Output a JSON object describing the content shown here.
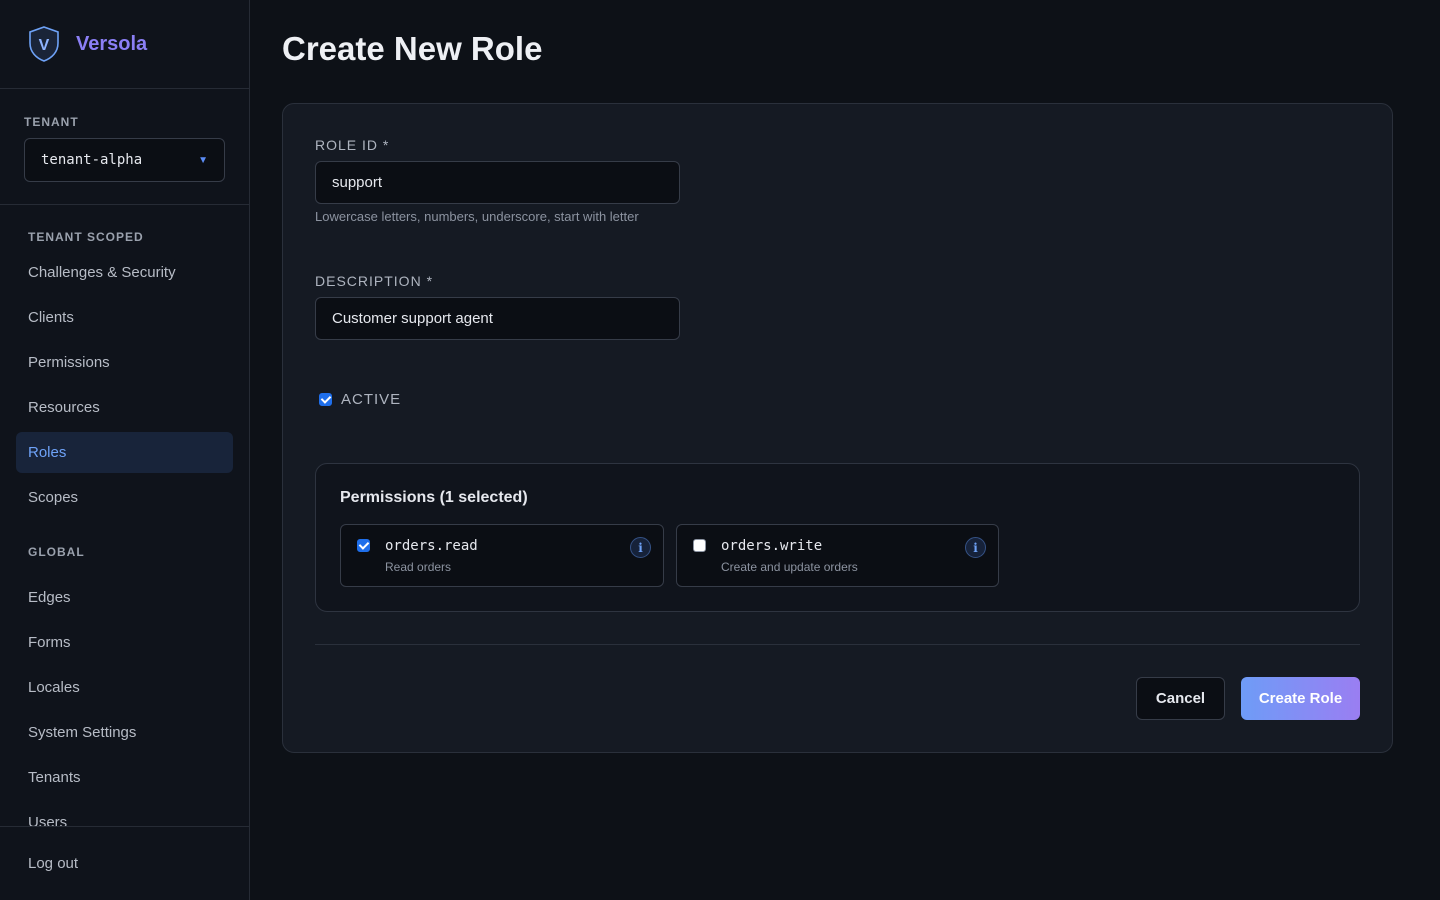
{
  "brand": {
    "name": "Versola",
    "logo_letter": "V"
  },
  "tenant": {
    "section_label": "TENANT",
    "selected": "tenant-alpha"
  },
  "nav": {
    "tenant_scoped_label": "TENANT SCOPED",
    "tenant_scoped": [
      "Challenges & Security",
      "Clients",
      "Permissions",
      "Resources",
      "Roles",
      "Scopes"
    ],
    "active_item": "Roles",
    "global_label": "GLOBAL",
    "global": [
      "Edges",
      "Forms",
      "Locales",
      "System Settings",
      "Tenants",
      "Users"
    ],
    "logout": "Log out"
  },
  "page": {
    "title": "Create New Role"
  },
  "form": {
    "role_id_label": "ROLE ID *",
    "role_id_value": "support",
    "role_id_hint": "Lowercase letters, numbers, underscore, start with letter",
    "description_label": "DESCRIPTION *",
    "description_value": "Customer support agent",
    "active_label": "ACTIVE",
    "active_checked": true,
    "permissions_title": "Permissions (1 selected)",
    "permissions": [
      {
        "name": "orders.read",
        "description": "Read orders",
        "checked": true
      },
      {
        "name": "orders.write",
        "description": "Create and update orders",
        "checked": false
      }
    ],
    "cancel_label": "Cancel",
    "submit_label": "Create Role"
  },
  "colors": {
    "accent": "#6ea2f7",
    "brand": "#8b7ff5",
    "background": "#0d1117",
    "card": "#151a23"
  }
}
